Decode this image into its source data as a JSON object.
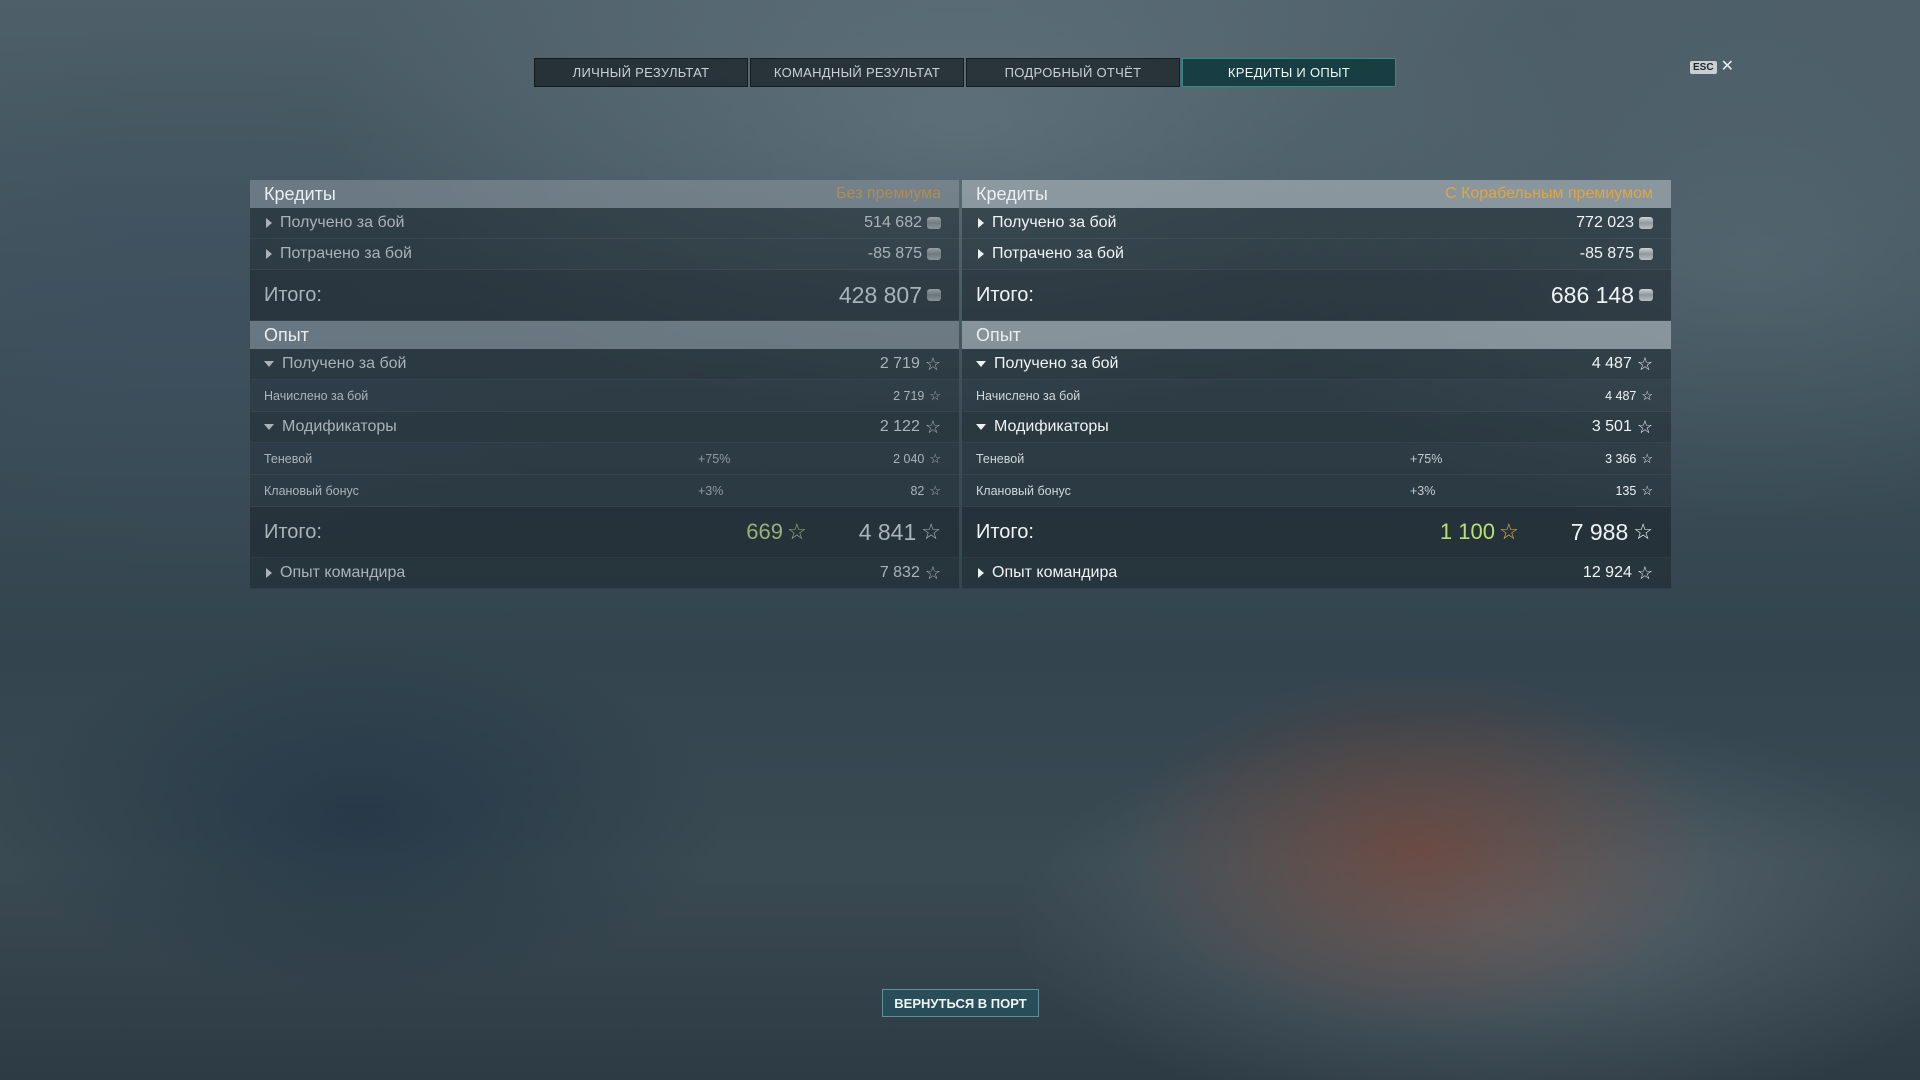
{
  "tabs": [
    {
      "label": "ЛИЧНЫЙ РЕЗУЛЬТАТ",
      "active": false
    },
    {
      "label": "КОМАНДНЫЙ РЕЗУЛЬТАТ",
      "active": false
    },
    {
      "label": "ПОДРОБНЫЙ ОТЧЁТ",
      "active": false
    },
    {
      "label": "КРЕДИТЫ И ОПЫТ",
      "active": true
    }
  ],
  "esc": {
    "badge": "ESC",
    "close": "✕"
  },
  "colors": {
    "premium_label": "#e0a640",
    "no_premium_label": "#b08d55",
    "bonus_left": "#98b07a",
    "bonus_right": "#b9e070",
    "accent_tab": "#2f8f87"
  },
  "left": {
    "credits": {
      "title": "Кредиты",
      "premium": "Без премиума",
      "earned_label": "Получено за бой",
      "earned_value": "514 682",
      "spent_label": "Потрачено за бой",
      "spent_value": "-85 875",
      "total_label": "Итого:",
      "total_value": "428 807"
    },
    "xp": {
      "title": "Опыт",
      "earned_label": "Получено за бой",
      "earned_value": "2 719",
      "accrued_label": "Начислено за бой",
      "accrued_value": "2 719",
      "modifiers_label": "Модификаторы",
      "modifiers_value": "2 122",
      "shadow_label": "Теневой",
      "shadow_pct": "+75%",
      "shadow_value": "2 040",
      "clan_label": "Клановый бонус",
      "clan_pct": "+3%",
      "clan_value": "82",
      "total_label": "Итого:",
      "total_bonus": "669",
      "total_value": "4 841",
      "commander_label": "Опыт командира",
      "commander_value": "7 832"
    }
  },
  "right": {
    "credits": {
      "title": "Кредиты",
      "premium": "С Корабельным премиумом",
      "earned_label": "Получено за бой",
      "earned_value": "772 023",
      "spent_label": "Потрачено за бой",
      "spent_value": "-85 875",
      "total_label": "Итого:",
      "total_value": "686 148"
    },
    "xp": {
      "title": "Опыт",
      "earned_label": "Получено за бой",
      "earned_value": "4 487",
      "accrued_label": "Начислено за бой",
      "accrued_value": "4 487",
      "modifiers_label": "Модификаторы",
      "modifiers_value": "3 501",
      "shadow_label": "Теневой",
      "shadow_pct": "+75%",
      "shadow_value": "3 366",
      "clan_label": "Клановый бонус",
      "clan_pct": "+3%",
      "clan_value": "135",
      "total_label": "Итого:",
      "total_bonus": "1 100",
      "total_value": "7 988",
      "commander_label": "Опыт командира",
      "commander_value": "12 924"
    }
  },
  "footer": {
    "return_label": "ВЕРНУТЬСЯ В ПОРТ"
  }
}
